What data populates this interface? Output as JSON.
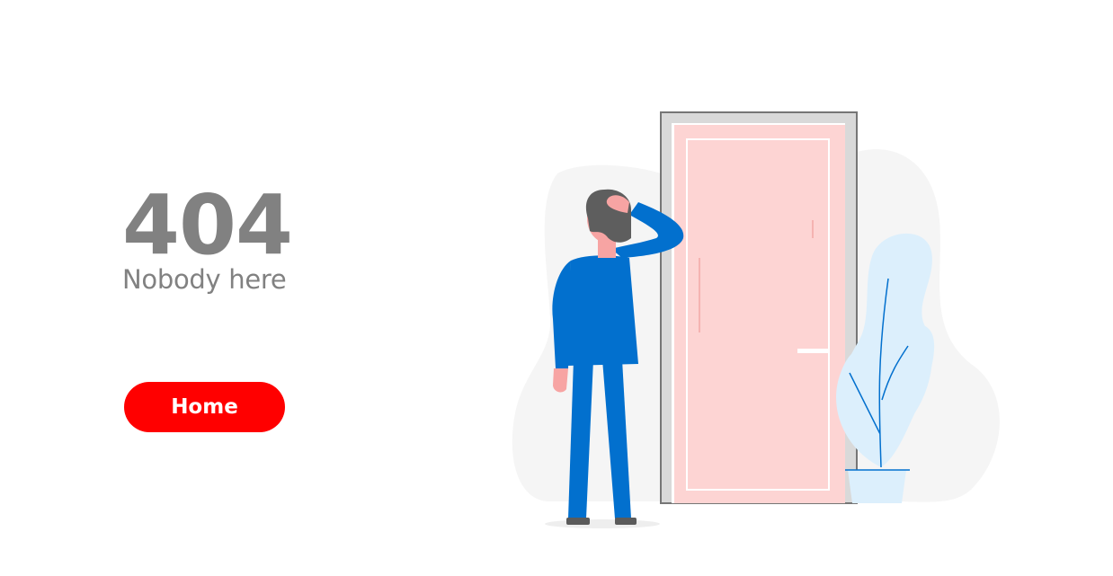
{
  "error": {
    "code": "404",
    "message": "Nobody here"
  },
  "actions": {
    "home_label": "Home"
  },
  "colors": {
    "accent": "#ff0000",
    "text": "#818181",
    "door": "#fdd4d3",
    "person_suit": "#0270ce",
    "plant": "#dceffc",
    "background_blob": "#f5f5f5"
  },
  "illustration": {
    "icon": "confused-man-at-door-illustration"
  }
}
